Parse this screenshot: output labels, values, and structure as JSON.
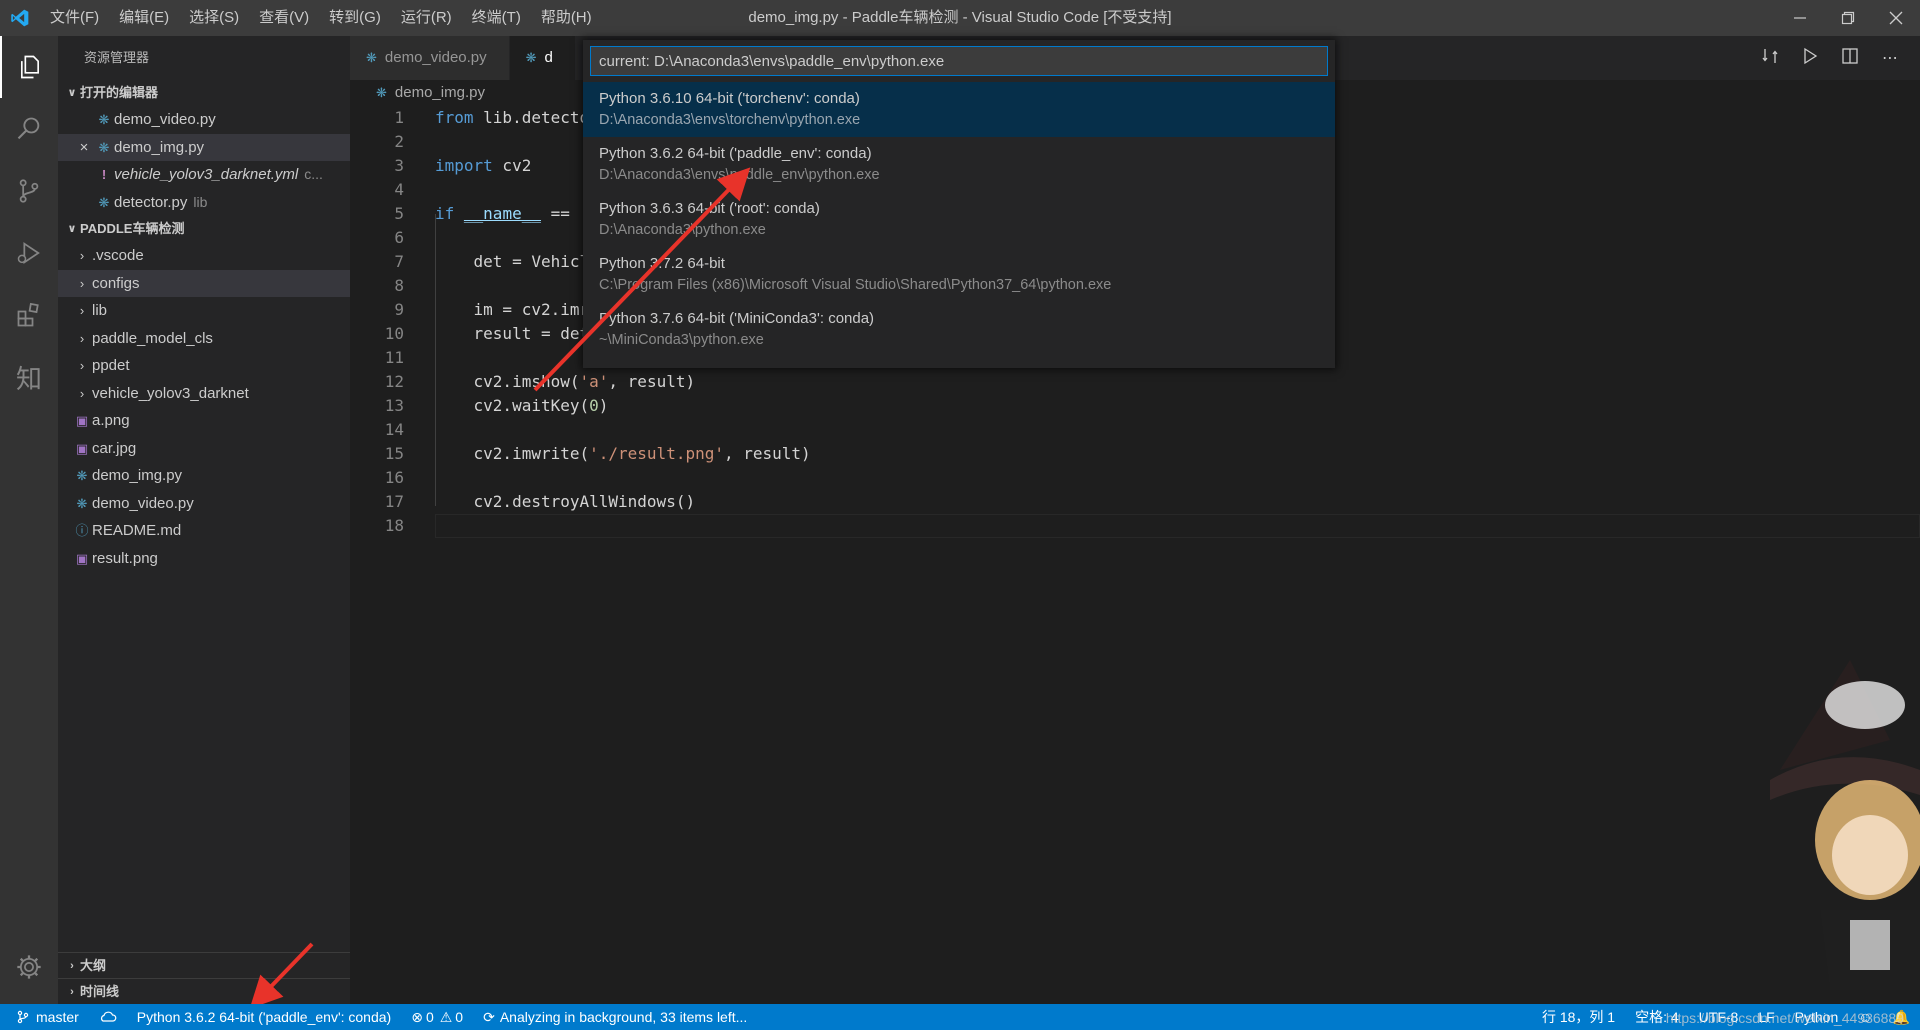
{
  "app": {
    "window_title": "demo_img.py - Paddle车辆检测 - Visual Studio Code [不受支持]",
    "menu": [
      "文件(F)",
      "编辑(E)",
      "选择(S)",
      "查看(V)",
      "转到(G)",
      "运行(R)",
      "终端(T)",
      "帮助(H)"
    ]
  },
  "sidebar": {
    "title": "资源管理器",
    "open_editors": {
      "header": "打开的编辑器",
      "items": [
        {
          "name": "demo_video.py",
          "desc": "",
          "icon": "python-file-icon"
        },
        {
          "name": "demo_img.py",
          "desc": "",
          "icon": "python-file-icon"
        },
        {
          "name": "vehicle_yolov3_darknet.yml",
          "desc": "c...",
          "icon": "yaml-file-icon"
        },
        {
          "name": "detector.py",
          "desc": "lib",
          "icon": "python-file-icon"
        }
      ]
    },
    "project": {
      "header": "PADDLE车辆检测",
      "folders": [
        ".vscode",
        "configs",
        "lib",
        "paddle_model_cls",
        "ppdet",
        "vehicle_yolov3_darknet"
      ],
      "files": [
        {
          "name": "a.png",
          "icon": "image-file-icon"
        },
        {
          "name": "car.jpg",
          "icon": "image-file-icon"
        },
        {
          "name": "demo_img.py",
          "icon": "python-file-icon"
        },
        {
          "name": "demo_video.py",
          "icon": "python-file-icon"
        },
        {
          "name": "README.md",
          "icon": "info-file-icon"
        },
        {
          "name": "result.png",
          "icon": "image-file-icon"
        }
      ]
    },
    "outline_header": "大纲",
    "timeline_header": "时间线"
  },
  "tabs": [
    {
      "label": "demo_video.py"
    },
    {
      "label": "d"
    }
  ],
  "breadcrumb": "demo_img.py",
  "editor": {
    "line_numbers": [
      "1",
      "2",
      "3",
      "4",
      "5",
      "6",
      "7",
      "8",
      "9",
      "10",
      "11",
      "12",
      "13",
      "14",
      "15",
      "16",
      "17",
      "18"
    ]
  },
  "quick_pick": {
    "input_value": "current: D:\\Anaconda3\\envs\\paddle_env\\python.exe",
    "items": [
      {
        "label": "Python 3.6.10 64-bit ('torchenv': conda)",
        "detail": "D:\\Anaconda3\\envs\\torchenv\\python.exe"
      },
      {
        "label": "Python 3.6.2 64-bit ('paddle_env': conda)",
        "detail": "D:\\Anaconda3\\envs\\paddle_env\\python.exe"
      },
      {
        "label": "Python 3.6.3 64-bit ('root': conda)",
        "detail": "D:\\Anaconda3\\python.exe"
      },
      {
        "label": "Python 3.7.2 64-bit",
        "detail": "C:\\Program Files (x86)\\Microsoft Visual Studio\\Shared\\Python37_64\\python.exe"
      },
      {
        "label": "Python 3.7.6 64-bit ('MiniConda3': conda)",
        "detail": "~\\MiniConda3\\python.exe"
      }
    ]
  },
  "statusbar": {
    "branch": "master",
    "interpreter": "Python 3.6.2 64-bit ('paddle_env': conda)",
    "errors": "0",
    "warnings": "0",
    "analysis": "Analyzing in background, 33 items left...",
    "position": "行 18，列 1",
    "spaces": "空格: 4",
    "encoding": "UTF-8",
    "eol": "LF",
    "language": "Python"
  },
  "watermark": "https://blog.csdn.net/weixin_44936889",
  "colors": {
    "statusbar": "#007acc",
    "activitybar": "#333333",
    "sidebar": "#252526",
    "editor": "#1e1e1e",
    "arrow": "#e8332a"
  }
}
